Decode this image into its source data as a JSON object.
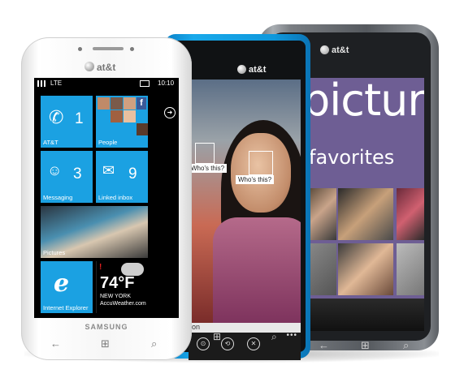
{
  "scene": "three Windows Phone handsets",
  "phones": {
    "grey": {
      "carrier": "at&t",
      "screen_title": "pictures",
      "screen_subtitle": "favorites",
      "nav": [
        "←",
        "⊞",
        "⌕"
      ]
    },
    "blue": {
      "carrier": "at&t",
      "tag_1": "Who's this?",
      "tag_2": "Who's this?",
      "caption_fragment": "on",
      "app_bar": [
        "⊙",
        "⟲",
        "✕"
      ],
      "nav": [
        "←",
        "⊞",
        "⌕"
      ]
    },
    "white": {
      "carrier": "at&t",
      "status": {
        "network": "LTE",
        "time": "10:10"
      },
      "maker": "SAMSUNG",
      "tiles": {
        "phone": {
          "label": "AT&T",
          "count": "1",
          "icon": "phone-icon"
        },
        "people": {
          "label": "People",
          "icon": "facebook-icon"
        },
        "messaging": {
          "label": "Messaging",
          "count": "3",
          "icon": "smiley-icon"
        },
        "mail": {
          "label": "Linked inbox",
          "count": "9",
          "icon": "mail-icon"
        },
        "pictures": {
          "label": "Pictures"
        },
        "ie": {
          "label": "Internet Explorer",
          "icon": "ie-icon"
        },
        "weather": {
          "temp": "74°F",
          "city": "NEW YORK",
          "source": "AccuWeather.com"
        }
      },
      "nav": [
        "←",
        "⊞",
        "⌕"
      ]
    }
  },
  "colors": {
    "tile_blue": "#1ba1e2",
    "nokia_cyan": "#19a9ea",
    "people_purple": "#6e5e94"
  }
}
